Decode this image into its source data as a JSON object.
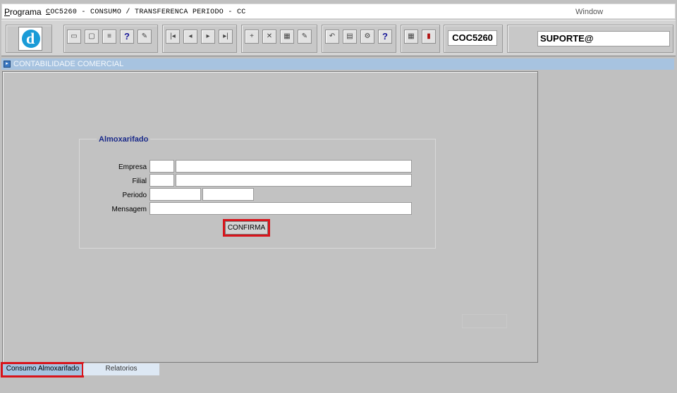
{
  "menubar": {
    "programa_first": "P",
    "programa_rest": "rograma",
    "program_code_first": "C",
    "program_title_rest": "OC5260 - CONSUMO / TRANSFERENCA PERIODO - CC",
    "window_label": "Window"
  },
  "toolbar": {
    "logo_letter": "d",
    "code": "COC5260",
    "user": "SUPORTE@",
    "buttons": [
      {
        "name": "save-icon",
        "glyph": "▭"
      },
      {
        "name": "window-icon",
        "glyph": "▢"
      },
      {
        "name": "print-icon",
        "glyph": "≡"
      },
      {
        "name": "help-query-icon",
        "glyph": "?"
      },
      {
        "name": "magic-icon",
        "glyph": "✎"
      },
      {
        "name": "first-record-icon",
        "glyph": "|◂"
      },
      {
        "name": "previous-record-icon",
        "glyph": "◂"
      },
      {
        "name": "next-record-icon",
        "glyph": "▸"
      },
      {
        "name": "last-record-icon",
        "glyph": "▸|"
      },
      {
        "name": "insert-record-icon",
        "glyph": "+"
      },
      {
        "name": "delete-record-icon",
        "glyph": "✕"
      },
      {
        "name": "clear-record-icon",
        "glyph": "▦"
      },
      {
        "name": "edit-record-icon",
        "glyph": "✎"
      },
      {
        "name": "undo-icon",
        "glyph": "↶"
      },
      {
        "name": "list-values-icon",
        "glyph": "▤"
      },
      {
        "name": "tools-icon",
        "glyph": "⚙"
      },
      {
        "name": "help-icon",
        "glyph": "?"
      },
      {
        "name": "calendar-icon",
        "glyph": "▦"
      },
      {
        "name": "exit-icon",
        "glyph": "▮"
      }
    ]
  },
  "window": {
    "title": "CONTABILIDADE COMERCIAL"
  },
  "form": {
    "frame_title": "Almoxarifado",
    "empresa_label": "Empresa",
    "filial_label": "Filial",
    "periodo_label": "Periodo",
    "mensagem_label": "Mensagem",
    "empresa_code": "",
    "empresa_name": "",
    "filial_code": "",
    "filial_name": "",
    "periodo_start": "",
    "periodo_end": "",
    "mensagem": "",
    "confirm_label": "CONFIRMA"
  },
  "tabs": [
    {
      "label": "Consumo Almoxarifado"
    },
    {
      "label": "Relatorios"
    }
  ],
  "colors": {
    "highlight": "#d8141b",
    "window_bar": "#a7c3e0",
    "frame_title": "#1a2a8a"
  }
}
